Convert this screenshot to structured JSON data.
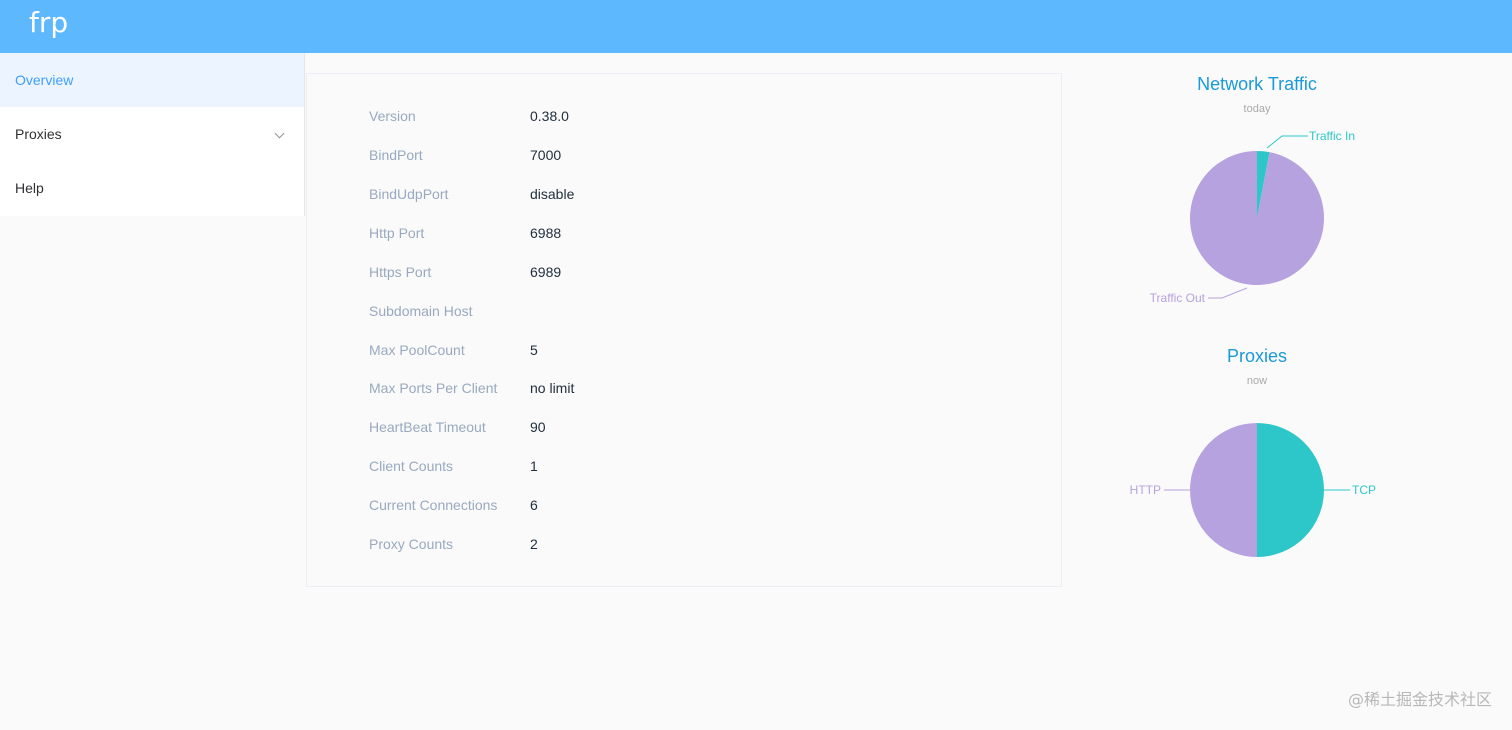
{
  "header": {
    "brand": "frp",
    "color": "#5db8fd"
  },
  "sidebar": {
    "items": [
      {
        "label": "Overview",
        "active": true
      },
      {
        "label": "Proxies",
        "icon": "chevron-down-icon"
      },
      {
        "label": "Help"
      }
    ]
  },
  "overview": {
    "rows": [
      {
        "label": "Version",
        "value": "0.38.0"
      },
      {
        "label": "BindPort",
        "value": "7000"
      },
      {
        "label": "BindUdpPort",
        "value": "disable"
      },
      {
        "label": "Http Port",
        "value": "6988"
      },
      {
        "label": "Https Port",
        "value": "6989"
      },
      {
        "label": "Subdomain Host",
        "value": ""
      },
      {
        "label": "Max PoolCount",
        "value": "5"
      },
      {
        "label": "Max Ports Per Client",
        "value": "no limit"
      },
      {
        "label": "HeartBeat Timeout",
        "value": "90"
      },
      {
        "label": "Client Counts",
        "value": "1"
      },
      {
        "label": "Current Connections",
        "value": "6"
      },
      {
        "label": "Proxy Counts",
        "value": "2"
      }
    ]
  },
  "chart_data": [
    {
      "type": "pie",
      "title": "Network Traffic",
      "subtitle": "today",
      "slices": [
        {
          "name": "Traffic In",
          "fraction": 0.03,
          "color": "#2ec7c9"
        },
        {
          "name": "Traffic Out",
          "fraction": 0.97,
          "color": "#b6a2de"
        }
      ]
    },
    {
      "type": "pie",
      "title": "Proxies",
      "subtitle": "now",
      "slices": [
        {
          "name": "TCP",
          "fraction": 0.5,
          "color": "#2ec7c9"
        },
        {
          "name": "HTTP",
          "fraction": 0.5,
          "color": "#b6a2de"
        }
      ]
    }
  ],
  "watermark": "@稀土掘金技术社区"
}
